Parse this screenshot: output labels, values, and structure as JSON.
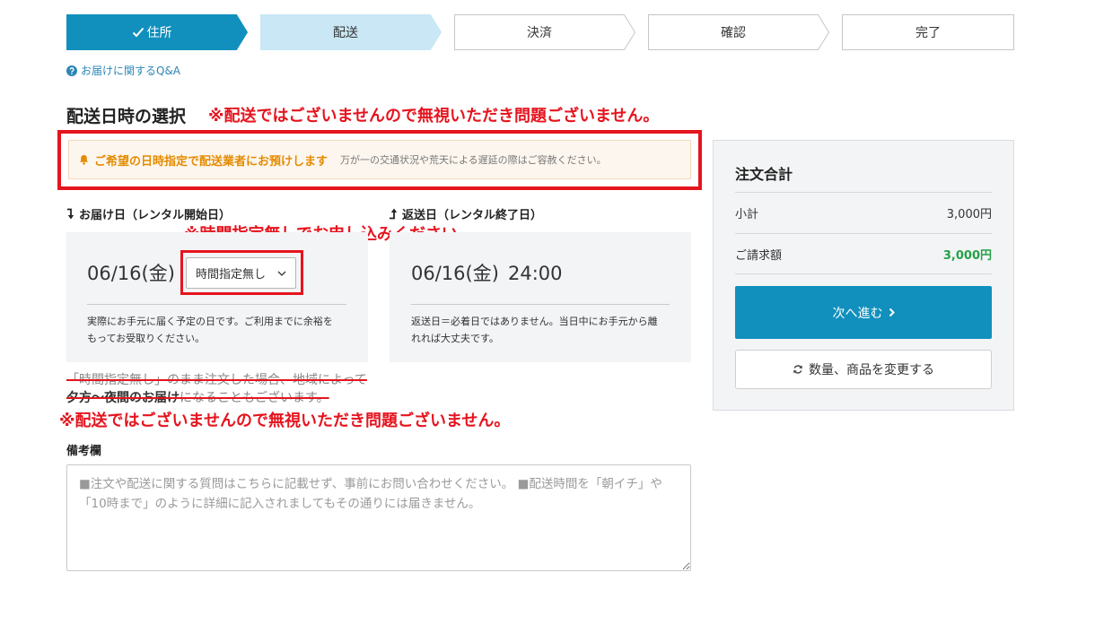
{
  "progress_steps": [
    {
      "label": "住所",
      "done": true,
      "icon": "check-icon"
    },
    {
      "label": "配送",
      "current": true
    },
    {
      "label": "決済"
    },
    {
      "label": "確認"
    },
    {
      "label": "完了"
    }
  ],
  "faq_link": {
    "icon": "question-circle-icon",
    "label": "お届けに関するQ&A"
  },
  "delivery_section": {
    "title": "配送日時の選択",
    "annotation": "※配送ではございませんので無視いただき問題ございません。"
  },
  "notice": {
    "icon": "bell-icon",
    "headline": "ご希望の日時指定で配送業者にお預けします",
    "note": "万が一の交通状況や荒天による遅延の際はご容赦ください。"
  },
  "start_date": {
    "icon": "arrow-down-turn-icon",
    "label": "お届け日（レンタル開始日）",
    "date": "06/16(金)",
    "time_select": {
      "selected": "時間指定無し",
      "icon": "chevron-down-icon"
    },
    "note": "実際にお手元に届く予定の日です。ご利用までに余裕をもってお受取りください。"
  },
  "time_annotation": "※時間指定無しでお申し込みください。",
  "return_date": {
    "icon": "arrow-up-turn-icon",
    "label": "返送日（レンタル終了日）",
    "date": "06/16(金)",
    "time": "24:00",
    "note": "返送日＝必着日ではありません。当日中にお手元から離れれば大丈夫です。"
  },
  "struck_warning": {
    "parts": [
      "「時間指定無し」のまま注文した場合、地域によって",
      "夕方～夜間のお届け",
      "になることもございます。"
    ],
    "strikethrough": true
  },
  "bottom_annotation": "※配送ではございませんので無視いただき問題ございません。",
  "remarks": {
    "label": "備考欄",
    "placeholder": "■注文や配送に関する質問はこちらに記載せず、事前にお問い合わせください。 ■配送時間を「朝イチ」や「10時まで」のように詳細に記入されましてもその通りには届きません。"
  },
  "order_summary": {
    "title": "注文合計",
    "subtotal_label": "小計",
    "subtotal_value": "3,000円",
    "total_label": "ご請求額",
    "total_value": "3,000円",
    "next_button": {
      "label": "次へ進む",
      "icon": "chevron-right-icon"
    },
    "change_button": {
      "label": "数量、商品を変更する",
      "icon": "refresh-icon"
    }
  },
  "colors": {
    "primary": "#1190bd",
    "primary_light": "#c9e7f4",
    "annotation": "#e5141e",
    "notice": "#e58b00",
    "notice_background": "#fdf6ee",
    "total": "#26a048"
  }
}
